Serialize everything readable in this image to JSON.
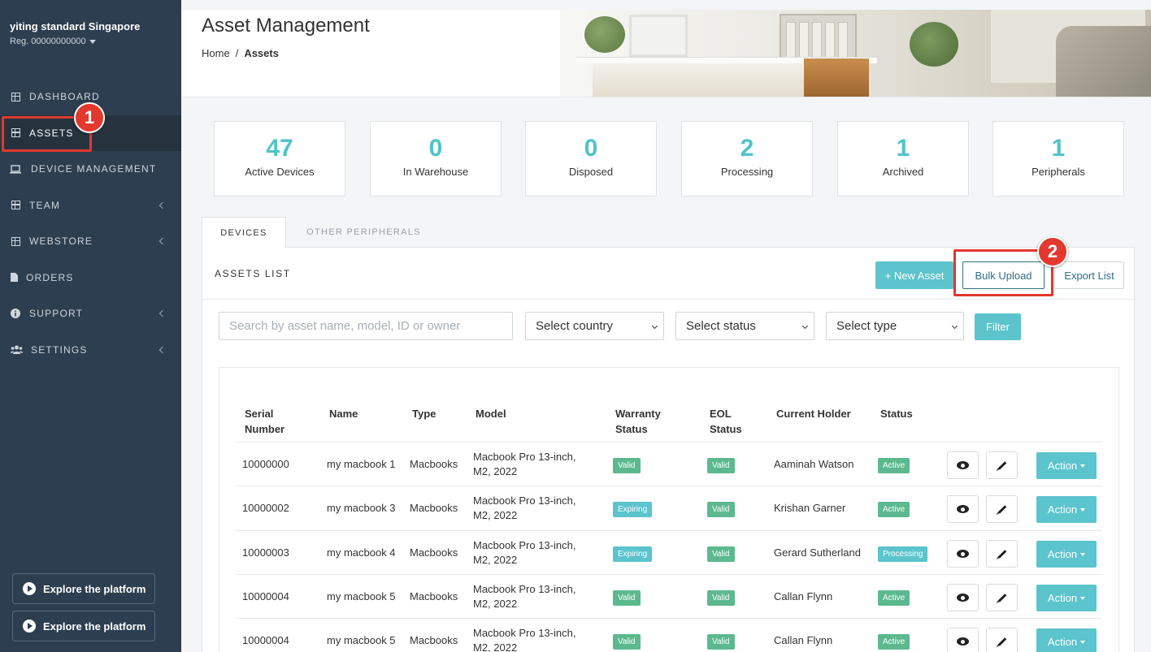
{
  "sidebar": {
    "org_name": "yiting standard Singapore",
    "org_reg": "Reg. 00000000000",
    "items": [
      {
        "label": "DASHBOARD",
        "icon": "grid-icon"
      },
      {
        "label": "ASSETS",
        "icon": "grid-icon"
      },
      {
        "label": "DEVICE MANAGEMENT",
        "icon": "laptop-icon"
      },
      {
        "label": "TEAM",
        "icon": "grid-icon"
      },
      {
        "label": "WEBSTORE",
        "icon": "grid-icon"
      },
      {
        "label": "ORDERS",
        "icon": "file-icon"
      },
      {
        "label": "SUPPORT",
        "icon": "info-icon"
      },
      {
        "label": "SETTINGS",
        "icon": "users-icon"
      }
    ],
    "explore_label": "Explore the platform"
  },
  "header": {
    "title": "Asset Management",
    "breadcrumb_home": "Home",
    "breadcrumb_sep": "/",
    "breadcrumb_current": "Assets"
  },
  "stats": [
    {
      "value": "47",
      "label": "Active Devices"
    },
    {
      "value": "0",
      "label": "In Warehouse"
    },
    {
      "value": "0",
      "label": "Disposed"
    },
    {
      "value": "2",
      "label": "Processing"
    },
    {
      "value": "1",
      "label": "Archived"
    },
    {
      "value": "1",
      "label": "Peripherals"
    }
  ],
  "tabs": [
    {
      "label": "DEVICES"
    },
    {
      "label": "OTHER PERIPHERALS"
    }
  ],
  "panel": {
    "title": "ASSETS LIST",
    "new_asset": "+ New Asset",
    "bulk_upload": "Bulk Upload",
    "export_list": "Export List",
    "search_placeholder": "Search by asset name, model, ID or owner",
    "select_country": "Select country",
    "select_status": "Select status",
    "select_type": "Select type",
    "filter": "Filter"
  },
  "annotations": {
    "one": "1",
    "two": "2"
  },
  "table": {
    "headers": {
      "serial": "Serial Number",
      "name": "Name",
      "type": "Type",
      "model": "Model",
      "warranty": "Warranty Status",
      "eol": "EOL Status",
      "holder": "Current Holder",
      "status": "Status"
    },
    "action_label": "Action",
    "rows": [
      {
        "serial": "10000000",
        "name": "my macbook 1",
        "type": "Macbooks",
        "model": "Macbook Pro 13-inch, M2, 2022",
        "warranty": "Valid",
        "eol": "Valid",
        "holder": "Aaminah Watson",
        "status": "Active"
      },
      {
        "serial": "10000002",
        "name": "my macbook 3",
        "type": "Macbooks",
        "model": "Macbook Pro 13-inch, M2, 2022",
        "warranty": "Expiring",
        "eol": "Valid",
        "holder": "Krishan Garner",
        "status": "Active"
      },
      {
        "serial": "10000003",
        "name": "my macbook 4",
        "type": "Macbooks",
        "model": "Macbook Pro 13-inch, M2, 2022",
        "warranty": "Expiring",
        "eol": "Valid",
        "holder": "Gerard Sutherland",
        "status": "Processing"
      },
      {
        "serial": "10000004",
        "name": "my macbook 5",
        "type": "Macbooks",
        "model": "Macbook Pro 13-inch, M2, 2022",
        "warranty": "Valid",
        "eol": "Valid",
        "holder": "Callan Flynn",
        "status": "Active"
      },
      {
        "serial": "10000004",
        "name": "my macbook 5",
        "type": "Macbooks",
        "model": "Macbook Pro 13-inch, M2, 2022",
        "warranty": "Valid",
        "eol": "Valid",
        "holder": "Callan Flynn",
        "status": "Active"
      }
    ]
  },
  "colors": {
    "sidebar_bg": "#2d3e50",
    "accent": "#5bc4cc",
    "stat_value": "#4fc3c9",
    "valid": "#5cb98f",
    "annotation": "#e2382e"
  }
}
